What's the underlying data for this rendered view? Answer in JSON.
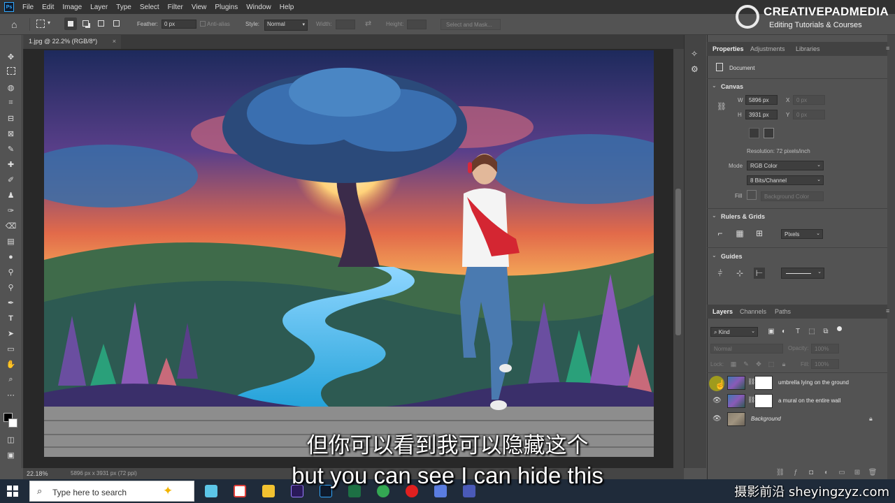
{
  "menubar": {
    "items": [
      "File",
      "Edit",
      "Image",
      "Layer",
      "Type",
      "Select",
      "Filter",
      "View",
      "Plugins",
      "Window",
      "Help"
    ]
  },
  "brand": {
    "name": "CREATIVEPADMEDIA",
    "tagline": "Editing Tutorials & Courses"
  },
  "options": {
    "feather_label": "Feather:",
    "feather_value": "0 px",
    "antialias_label": "Anti-alias",
    "style_label": "Style:",
    "style_value": "Normal",
    "width_label": "Width:",
    "height_label": "Height:",
    "select_mask_label": "Select and Mask..."
  },
  "document": {
    "tab_title": "1.jpg @ 22.2% (RGB/8*)",
    "zoom": "22.18%",
    "dimensions": "5896 px x 3931 px (72 ppi)"
  },
  "properties": {
    "tabs": [
      "Properties",
      "Adjustments",
      "Libraries"
    ],
    "doc_label": "Document",
    "canvas_section": "Canvas",
    "w_label": "W",
    "w_value": "5896 px",
    "h_label": "H",
    "h_value": "3931 px",
    "x_label": "X",
    "x_value": "0 px",
    "y_label": "Y",
    "y_value": "0 px",
    "resolution": "Resolution: 72 pixels/inch",
    "mode_label": "Mode",
    "mode_value": "RGB Color",
    "bits_value": "8 Bits/Channel",
    "fill_label": "Fill",
    "fill_value": "Background Color",
    "rulers_section": "Rulers & Grids",
    "units_value": "Pixels",
    "guides_section": "Guides"
  },
  "layers": {
    "tabs": [
      "Layers",
      "Channels",
      "Paths"
    ],
    "kind_value": "Kind",
    "blend_value": "Normal",
    "opacity_label": "Opacity:",
    "opacity_value": "100%",
    "lock_label": "Lock:",
    "fill_label": "Fill:",
    "fill_value": "100%",
    "rows": [
      {
        "name": "umbrella lying on the ground"
      },
      {
        "name": "a mural on the entire wall"
      },
      {
        "name": "Background"
      }
    ]
  },
  "subtitles": {
    "chinese": "但你可以看到我可以隐藏这个",
    "english": "but you can see I can hide this"
  },
  "taskbar": {
    "search_placeholder": "Type here to search",
    "watermark": "摄影前沿 sheyingzyz.com"
  }
}
